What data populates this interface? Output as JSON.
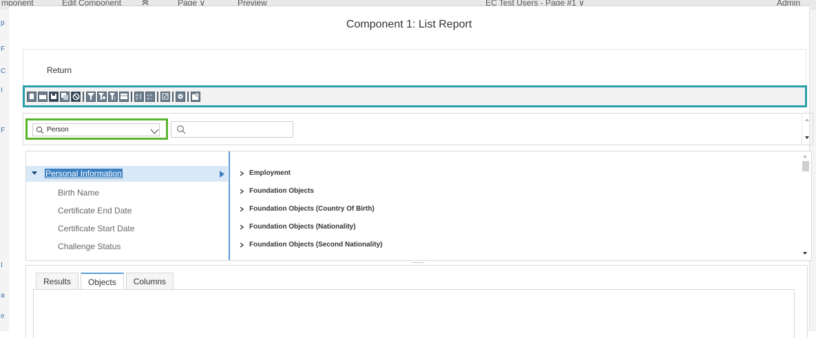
{
  "background": {
    "topbar": [
      "mponent",
      "Edit Component",
      "Page ∨",
      "Preview",
      "EC Test Users - Page #1 ∨",
      "Admin"
    ],
    "left_letters": [
      "p",
      "F",
      "C",
      "I",
      "F",
      "I",
      "a",
      "e"
    ]
  },
  "dialog": {
    "title": "Component 1: List Report",
    "return_label": "Return"
  },
  "toolbar": {
    "accent": "#2a9fa8",
    "groups": [
      [
        "new-icon",
        "open-icon",
        "save-icon",
        "save-as-icon",
        "cancel-icon"
      ],
      [
        "filter-icon",
        "filter-value-icon",
        "filter-prompt-icon",
        "filter-table-icon"
      ],
      [
        "sort-icon",
        "calculate-icon"
      ],
      [
        "edit-icon"
      ],
      [
        "settings-icon"
      ],
      [
        "schedule-icon"
      ]
    ]
  },
  "filter": {
    "scope_value": "Person",
    "highlight_color": "#5ab52e",
    "search_value": ""
  },
  "tree": {
    "selected": "Personal Information",
    "children": [
      "Birth Name",
      "Certificate End Date",
      "Certificate Start Date",
      "Challenge Status"
    ],
    "objects": [
      "Employment",
      "Foundation Objects",
      "Foundation Objects (Country Of Birth)",
      "Foundation Objects (Nationality)",
      "Foundation Objects (Second Nationality)"
    ]
  },
  "tabs": [
    {
      "label": "Results",
      "active": false
    },
    {
      "label": "Objects",
      "active": true
    },
    {
      "label": "Columns",
      "active": false
    }
  ]
}
